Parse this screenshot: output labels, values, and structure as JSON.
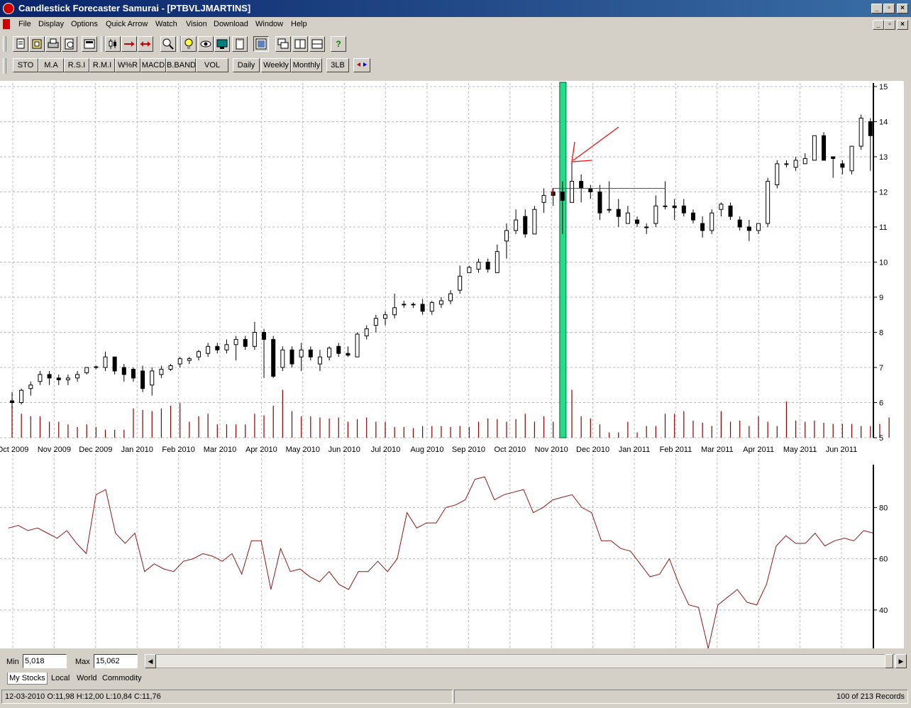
{
  "window": {
    "title": "Candlestick Forecaster Samurai - [PTBVLJMARTINS]",
    "controls": [
      "_",
      "▫",
      "×"
    ]
  },
  "menu": [
    "File",
    "Display",
    "Options",
    "Quick Arrow",
    "Watch",
    "Vision",
    "Download",
    "Window",
    "Help"
  ],
  "toolbar_icons": [
    "new-icon",
    "open-icon",
    "print-icon",
    "preview-icon",
    "calculator-icon",
    "candle-icon",
    "arrow-right-icon",
    "arrows-both-icon",
    "zoom-icon",
    "bulb-icon",
    "eye-icon",
    "monitor-icon",
    "clipboard-icon",
    "layout-icon",
    "cascade-icon",
    "tile-vertical-icon",
    "tile-horizontal-icon",
    "help-icon"
  ],
  "help_glyph": "?",
  "indicators": [
    "STO",
    "M.A",
    "R.S.I",
    "R.M.I",
    "W%R",
    "MACD",
    "B.BAND",
    "VOL"
  ],
  "periods": [
    "Daily",
    "Weekly",
    "Monthly"
  ],
  "extra_buttons": [
    "3LB"
  ],
  "colors": {
    "up_candle": "#ffffff",
    "down_candle": "#000000",
    "volume": "#8b0000",
    "highlight": "#22dd88",
    "annotation": "#ee1111",
    "oscillator": "#8b1a1a"
  },
  "chart_data": [
    {
      "type": "candlestick",
      "x_tick_labels": [
        "Oct 2009",
        "Nov 2009",
        "Dec 2009",
        "Jan 2010",
        "Feb 2010",
        "Mar 2010",
        "Apr 2010",
        "May 2010",
        "Jun 2010",
        "Jul 2010",
        "Aug 2010",
        "Sep 2010",
        "Oct 2010",
        "Nov 2010",
        "Dec 2010",
        "Jan 2011",
        "Feb 2011",
        "Mar 2011",
        "Apr 2011",
        "May 2011",
        "Jun 2011"
      ],
      "y_ticks": [
        "5",
        "6",
        "7",
        "8",
        "9",
        "10",
        "11",
        "12",
        "13",
        "14",
        "15"
      ],
      "ylim": [
        5,
        15.1
      ],
      "grid": true,
      "axis_side": "right",
      "highlight_index": 59,
      "annotation_level": 12.1,
      "candles": [
        {
          "o": 6.05,
          "h": 6.3,
          "l": 5.85,
          "c": 6.0
        },
        {
          "o": 6.0,
          "h": 6.4,
          "l": 5.95,
          "c": 6.35
        },
        {
          "o": 6.4,
          "h": 6.6,
          "l": 6.2,
          "c": 6.5
        },
        {
          "o": 6.6,
          "h": 6.9,
          "l": 6.5,
          "c": 6.8
        },
        {
          "o": 6.8,
          "h": 6.9,
          "l": 6.5,
          "c": 6.7
        },
        {
          "o": 6.7,
          "h": 6.8,
          "l": 6.5,
          "c": 6.65
        },
        {
          "o": 6.65,
          "h": 6.8,
          "l": 6.5,
          "c": 6.7
        },
        {
          "o": 6.7,
          "h": 6.9,
          "l": 6.6,
          "c": 6.8
        },
        {
          "o": 6.85,
          "h": 7.0,
          "l": 6.8,
          "c": 7.0
        },
        {
          "o": 7.0,
          "h": 7.05,
          "l": 6.95,
          "c": 7.02
        },
        {
          "o": 7.0,
          "h": 7.45,
          "l": 6.9,
          "c": 7.3
        },
        {
          "o": 7.3,
          "h": 7.3,
          "l": 6.8,
          "c": 6.9
        },
        {
          "o": 7.0,
          "h": 7.1,
          "l": 6.6,
          "c": 6.8
        },
        {
          "o": 6.95,
          "h": 7.0,
          "l": 6.6,
          "c": 6.7
        },
        {
          "o": 6.9,
          "h": 7.05,
          "l": 6.3,
          "c": 6.4
        },
        {
          "o": 6.5,
          "h": 7.0,
          "l": 6.2,
          "c": 6.9
        },
        {
          "o": 6.8,
          "h": 7.05,
          "l": 6.7,
          "c": 6.95
        },
        {
          "o": 6.95,
          "h": 7.1,
          "l": 6.9,
          "c": 7.05
        },
        {
          "o": 7.1,
          "h": 7.3,
          "l": 7.0,
          "c": 7.25
        },
        {
          "o": 7.2,
          "h": 7.3,
          "l": 7.1,
          "c": 7.25
        },
        {
          "o": 7.3,
          "h": 7.5,
          "l": 7.2,
          "c": 7.45
        },
        {
          "o": 7.4,
          "h": 7.7,
          "l": 7.3,
          "c": 7.6
        },
        {
          "o": 7.6,
          "h": 7.7,
          "l": 7.4,
          "c": 7.5
        },
        {
          "o": 7.5,
          "h": 7.8,
          "l": 7.4,
          "c": 7.65
        },
        {
          "o": 7.65,
          "h": 7.9,
          "l": 7.2,
          "c": 7.8
        },
        {
          "o": 7.8,
          "h": 7.9,
          "l": 7.5,
          "c": 7.6
        },
        {
          "o": 7.6,
          "h": 8.3,
          "l": 7.5,
          "c": 8.0
        },
        {
          "o": 8.0,
          "h": 8.1,
          "l": 6.7,
          "c": 7.8
        },
        {
          "o": 7.8,
          "h": 7.9,
          "l": 6.7,
          "c": 6.75
        },
        {
          "o": 7.0,
          "h": 7.6,
          "l": 6.9,
          "c": 7.5
        },
        {
          "o": 7.5,
          "h": 7.6,
          "l": 7.0,
          "c": 7.1
        },
        {
          "o": 7.3,
          "h": 7.7,
          "l": 6.9,
          "c": 7.5
        },
        {
          "o": 7.5,
          "h": 7.6,
          "l": 7.2,
          "c": 7.3
        },
        {
          "o": 7.1,
          "h": 7.5,
          "l": 6.9,
          "c": 7.3
        },
        {
          "o": 7.3,
          "h": 7.6,
          "l": 7.2,
          "c": 7.55
        },
        {
          "o": 7.6,
          "h": 7.7,
          "l": 7.3,
          "c": 7.4
        },
        {
          "o": 7.4,
          "h": 7.6,
          "l": 7.3,
          "c": 7.35
        },
        {
          "o": 7.3,
          "h": 8.0,
          "l": 7.3,
          "c": 7.95
        },
        {
          "o": 7.9,
          "h": 8.2,
          "l": 7.8,
          "c": 8.1
        },
        {
          "o": 8.2,
          "h": 8.5,
          "l": 8.0,
          "c": 8.4
        },
        {
          "o": 8.4,
          "h": 8.6,
          "l": 8.2,
          "c": 8.5
        },
        {
          "o": 8.5,
          "h": 9.1,
          "l": 8.4,
          "c": 8.7
        },
        {
          "o": 8.8,
          "h": 8.9,
          "l": 8.7,
          "c": 8.8
        },
        {
          "o": 8.8,
          "h": 8.85,
          "l": 8.7,
          "c": 8.8
        },
        {
          "o": 8.8,
          "h": 8.95,
          "l": 8.5,
          "c": 8.6
        },
        {
          "o": 8.6,
          "h": 8.9,
          "l": 8.5,
          "c": 8.85
        },
        {
          "o": 8.8,
          "h": 9.0,
          "l": 8.7,
          "c": 8.9
        },
        {
          "o": 8.9,
          "h": 9.2,
          "l": 8.8,
          "c": 9.1
        },
        {
          "o": 9.2,
          "h": 9.9,
          "l": 9.1,
          "c": 9.6
        },
        {
          "o": 9.7,
          "h": 9.9,
          "l": 9.7,
          "c": 9.85
        },
        {
          "o": 9.8,
          "h": 10.1,
          "l": 9.7,
          "c": 10.0
        },
        {
          "o": 10.0,
          "h": 10.1,
          "l": 9.7,
          "c": 9.8
        },
        {
          "o": 9.7,
          "h": 10.5,
          "l": 9.7,
          "c": 10.3
        },
        {
          "o": 10.6,
          "h": 11.1,
          "l": 10.1,
          "c": 10.9
        },
        {
          "o": 10.9,
          "h": 11.5,
          "l": 10.8,
          "c": 11.2
        },
        {
          "o": 11.3,
          "h": 11.5,
          "l": 10.7,
          "c": 10.8
        },
        {
          "o": 10.8,
          "h": 11.6,
          "l": 10.8,
          "c": 11.5
        },
        {
          "o": 11.7,
          "h": 12.1,
          "l": 11.4,
          "c": 11.9
        },
        {
          "o": 12.0,
          "h": 12.1,
          "l": 11.6,
          "c": 11.9
        },
        {
          "o": 12.0,
          "h": 12.3,
          "l": 10.8,
          "c": 11.76
        },
        {
          "o": 11.7,
          "h": 12.9,
          "l": 11.7,
          "c": 12.3
        },
        {
          "o": 12.3,
          "h": 12.5,
          "l": 11.7,
          "c": 12.1
        },
        {
          "o": 12.1,
          "h": 12.2,
          "l": 11.8,
          "c": 12.0
        },
        {
          "o": 12.0,
          "h": 12.2,
          "l": 11.2,
          "c": 11.4
        },
        {
          "o": 11.5,
          "h": 12.3,
          "l": 11.4,
          "c": 11.5
        },
        {
          "o": 11.5,
          "h": 11.8,
          "l": 11.0,
          "c": 11.3
        },
        {
          "o": 11.1,
          "h": 11.6,
          "l": 11.1,
          "c": 11.4
        },
        {
          "o": 11.2,
          "h": 11.3,
          "l": 11.0,
          "c": 11.1
        },
        {
          "o": 11.0,
          "h": 11.1,
          "l": 10.8,
          "c": 11.0
        },
        {
          "o": 11.1,
          "h": 11.9,
          "l": 11.0,
          "c": 11.6
        },
        {
          "o": 11.6,
          "h": 12.3,
          "l": 11.5,
          "c": 11.6
        },
        {
          "o": 11.6,
          "h": 11.8,
          "l": 11.2,
          "c": 11.55
        },
        {
          "o": 11.6,
          "h": 11.8,
          "l": 11.3,
          "c": 11.4
        },
        {
          "o": 11.4,
          "h": 11.5,
          "l": 11.1,
          "c": 11.2
        },
        {
          "o": 11.1,
          "h": 11.3,
          "l": 10.7,
          "c": 10.9
        },
        {
          "o": 10.9,
          "h": 11.5,
          "l": 10.8,
          "c": 11.4
        },
        {
          "o": 11.5,
          "h": 11.7,
          "l": 11.3,
          "c": 11.65
        },
        {
          "o": 11.6,
          "h": 11.7,
          "l": 11.2,
          "c": 11.3
        },
        {
          "o": 11.2,
          "h": 11.3,
          "l": 10.9,
          "c": 11.0
        },
        {
          "o": 11.0,
          "h": 11.2,
          "l": 10.6,
          "c": 10.9
        },
        {
          "o": 10.9,
          "h": 11.1,
          "l": 10.8,
          "c": 11.1
        },
        {
          "o": 11.1,
          "h": 12.4,
          "l": 11.0,
          "c": 12.3
        },
        {
          "o": 12.2,
          "h": 12.9,
          "l": 12.1,
          "c": 12.8
        },
        {
          "o": 12.8,
          "h": 12.9,
          "l": 12.7,
          "c": 12.8
        },
        {
          "o": 12.7,
          "h": 13.0,
          "l": 12.6,
          "c": 12.9
        },
        {
          "o": 12.8,
          "h": 13.1,
          "l": 12.8,
          "c": 12.95
        },
        {
          "o": 12.9,
          "h": 13.6,
          "l": 12.9,
          "c": 13.6
        },
        {
          "o": 13.6,
          "h": 13.7,
          "l": 12.9,
          "c": 12.9
        },
        {
          "o": 13.0,
          "h": 13.0,
          "l": 12.4,
          "c": 12.95
        },
        {
          "o": 12.8,
          "h": 12.9,
          "l": 12.5,
          "c": 12.7
        },
        {
          "o": 12.6,
          "h": 13.3,
          "l": 12.5,
          "c": 13.3
        },
        {
          "o": 13.3,
          "h": 14.2,
          "l": 13.2,
          "c": 14.1
        },
        {
          "o": 14.0,
          "h": 14.1,
          "l": 12.6,
          "c": 13.6
        }
      ],
      "volume_levels": [
        0.6,
        0.45,
        0.4,
        0.4,
        0.3,
        0.3,
        0.25,
        0.2,
        0.25,
        0.2,
        0.15,
        0.15,
        0.15,
        0.55,
        0.52,
        0.5,
        0.55,
        0.6,
        0.65,
        0.3,
        0.4,
        0.45,
        0.25,
        0.25,
        0.25,
        0.25,
        0.45,
        0.42,
        0.6,
        0.9,
        0.5,
        0.4,
        0.4,
        0.38,
        0.36,
        0.38,
        0.3,
        0.35,
        0.38,
        0.3,
        0.3,
        0.2,
        0.2,
        0.18,
        0.22,
        0.22,
        0.22,
        0.2,
        0.22,
        0.2,
        0.3,
        0.36,
        0.35,
        0.3,
        0.35,
        0.45,
        0.3,
        0.4,
        0.3,
        0.2,
        0.9,
        0.4,
        0.36,
        0.25,
        0.1,
        0.1,
        0.3,
        0.1,
        0.22,
        0.22,
        0.45,
        0.45,
        0.5,
        0.32,
        0.28,
        0.22,
        0.5,
        0.3,
        0.32,
        0.22,
        0.4,
        0.3,
        0.22,
        0.68,
        0.32,
        0.3,
        0.32,
        0.28,
        0.26,
        0.26,
        0.26,
        0.22,
        0.22,
        0.26,
        0.38
      ]
    },
    {
      "type": "line",
      "y_ticks": [
        "40",
        "60",
        "80"
      ],
      "ylim": [
        25,
        97
      ],
      "values": [
        72,
        73,
        71,
        72,
        70,
        68,
        71,
        66,
        62,
        85,
        87,
        70,
        66,
        70,
        55,
        58,
        56,
        55,
        59,
        60,
        62,
        61,
        59,
        62,
        54,
        67,
        67,
        48,
        64,
        55,
        56,
        53,
        51,
        55,
        50,
        48,
        55,
        55,
        59,
        55,
        60,
        78,
        72,
        74,
        74,
        80,
        81,
        83,
        91,
        92,
        83,
        85,
        86,
        87,
        78,
        80,
        83,
        84,
        85,
        80,
        78,
        67,
        67,
        64,
        63,
        58,
        53,
        54,
        60,
        50,
        42,
        41,
        25,
        42,
        45,
        48,
        43,
        42,
        50,
        65,
        69,
        66,
        66,
        70,
        65,
        67,
        68,
        67,
        71,
        70
      ]
    }
  ],
  "scale": {
    "min_label": "Min",
    "min_value": "5,018",
    "max_label": "Max",
    "max_value": "15,062"
  },
  "tabs": [
    "My Stocks",
    "Local",
    "World",
    "Commodity"
  ],
  "status": {
    "ohlc": "12-03-2010 O:11,98 H:12,00 L:10,84 C:11,76",
    "records": "100 of   213 Records"
  }
}
